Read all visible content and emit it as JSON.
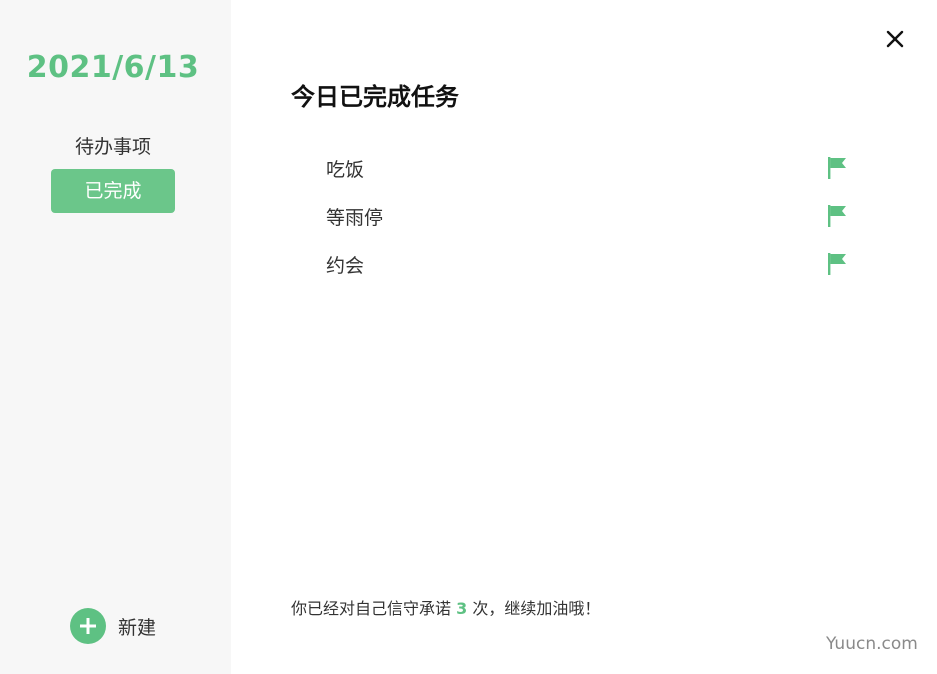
{
  "sidebar": {
    "date": "2021/6/13",
    "nav": [
      {
        "label": "待办事项",
        "active": false
      },
      {
        "label": "已完成",
        "active": true
      }
    ],
    "new_label": "新建"
  },
  "main": {
    "title": "今日已完成任务",
    "tasks": [
      {
        "label": "吃饭"
      },
      {
        "label": "等雨停"
      },
      {
        "label": "约会"
      }
    ],
    "footer": {
      "prefix": "你已经对自己信守承诺 ",
      "count": "3",
      "suffix": " 次，继续加油哦！"
    }
  },
  "watermark": "Yuucn.com",
  "icons": {
    "close": "close-icon",
    "flag": "flag-icon",
    "new": "plus-icon"
  },
  "colors": {
    "accent": "#5ec183",
    "active_nav_bg": "#6bc68a",
    "sidebar_bg": "#f7f7f7"
  }
}
